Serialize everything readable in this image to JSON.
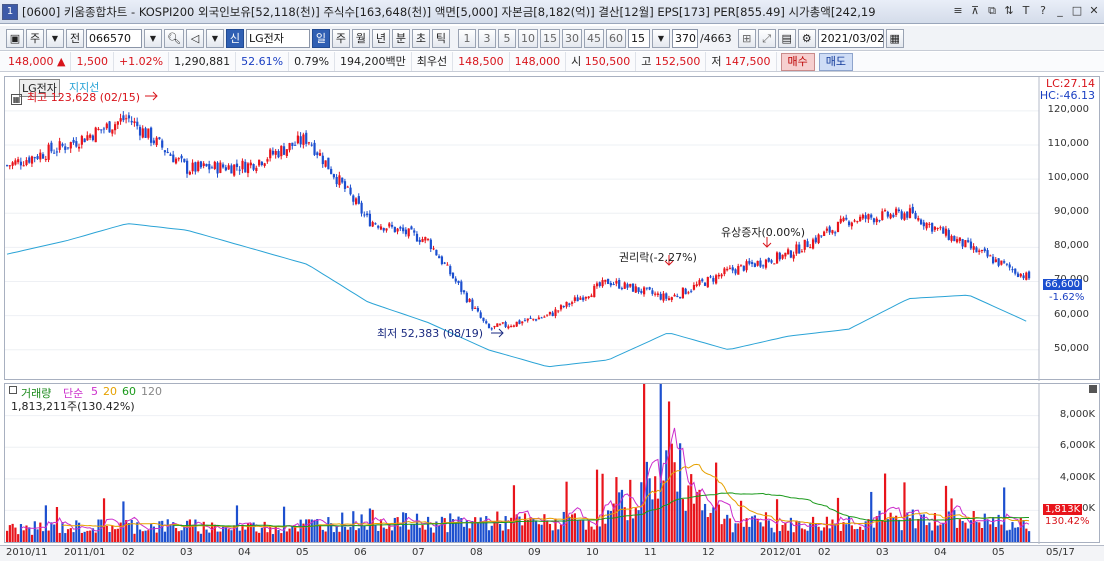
{
  "window": {
    "number": "1",
    "title": "[0600] 키움종합차트 - KOSPI200 외국인보유[52,118(천)] 주식수[163,648(천)] 액면[5,000] 자본금[8,182(억)] 결산[12월] EPS[173] PER[855.49] 시가총액[242,19",
    "title_icons": [
      "menu-icon",
      "pin-icon",
      "restore-icon",
      "layout-icon",
      "text-size-icon",
      "help-icon",
      "minimize-icon",
      "maximize-icon",
      "close-icon"
    ],
    "title_icon_glyphs": [
      "≡",
      "⊼",
      "⧉",
      "⇅",
      "T",
      "?",
      "_",
      "□",
      "✕"
    ]
  },
  "toolbar": {
    "mode1": "주",
    "mode2": "전",
    "stock_code": "066570",
    "stock_badge": "신",
    "stock_name": "LG전자",
    "periods": [
      "일",
      "주",
      "월",
      "년",
      "분",
      "초",
      "틱"
    ],
    "active_period": "일",
    "intervals": [
      "1",
      "3",
      "5",
      "10",
      "15",
      "30",
      "45",
      "60"
    ],
    "interval_value": "15",
    "count_value": "370",
    "count_total": "/4663",
    "date_value": "2021/03/02"
  },
  "quote": {
    "price": "148,000",
    "change_arrow": "▲",
    "change": "1,500",
    "change_pct": "+1.02%",
    "volume": "1,290,881",
    "ratio1": "52.61%",
    "ratio2": "0.79%",
    "amount": "194,200백만",
    "best_label": "최우선",
    "ask": "148,500",
    "bid": "148,000",
    "open_label": "시",
    "open": "150,500",
    "high_label": "고",
    "high": "152,500",
    "low_label": "저",
    "low": "147,500",
    "buy_label": "매수",
    "sell_label": "매도"
  },
  "price_panel": {
    "series_name": "LG전자",
    "indicator_name": "지지선",
    "lc_label": "LC:27.14",
    "hc_label": "HC:-46.13",
    "high_annotation": "최고 123,628 (02/15)",
    "low_annotation": "최저 52,383 (08/19)",
    "event1": "권리락(-2.27%)",
    "event2": "유상증자(0.00%)",
    "current_price": "66,600",
    "current_pct": "-1.62%",
    "y_ticks": [
      "120,000",
      "110,000",
      "100,000",
      "90,000",
      "80,000",
      "70,000",
      "60,000",
      "50,000"
    ]
  },
  "volume_panel": {
    "title": "거래량",
    "ma_label": "단순",
    "ma_periods": [
      "5",
      "20",
      "60",
      "120"
    ],
    "ma_colors": [
      "#cc2fcc",
      "#e6a100",
      "#1b9a1b",
      "#888888"
    ],
    "current_volume": "1,813,211주(130.42%)",
    "current_badge": "1,813K",
    "current_pct": "130.42%",
    "y_ticks": [
      "8,000K",
      "6,000K",
      "4,000K",
      "2,000K"
    ]
  },
  "x_axis": {
    "labels": [
      "2010/11",
      "2011/01",
      "02",
      "03",
      "04",
      "05",
      "06",
      "07",
      "08",
      "09",
      "10",
      "11",
      "12",
      "2012/01",
      "02",
      "03",
      "04",
      "05",
      "05/17"
    ]
  },
  "colors": {
    "up": "#e8141b",
    "down": "#1c4fcf",
    "support_line": "#2aa3d6",
    "accent": "#2f5fb3"
  },
  "chart_data": {
    "type": "line",
    "title": "LG전자",
    "x": [
      "2010/11",
      "2011/01",
      "02",
      "03",
      "04",
      "05",
      "06",
      "07",
      "08",
      "09",
      "10",
      "11",
      "12",
      "2012/01",
      "02",
      "03",
      "04",
      "05"
    ],
    "series": [
      {
        "name": "LG전자",
        "values": [
          104000,
          110000,
          118000,
          103000,
          104000,
          112000,
          88000,
          82000,
          56000,
          60000,
          70000,
          65000,
          73000,
          78000,
          88000,
          90000,
          80000,
          71000
        ]
      },
      {
        "name": "지지선",
        "values": [
          78000,
          82000,
          87000,
          85000,
          80000,
          75000,
          64000,
          58000,
          50000,
          45000,
          47000,
          55000,
          50000,
          54000,
          56000,
          65000,
          66000,
          58000
        ]
      }
    ],
    "volume_series": {
      "name": "거래량",
      "values_k": [
        1500,
        1700,
        1900,
        1800,
        1600,
        2000,
        2600,
        2100,
        2400,
        2200,
        2800,
        8900,
        2200,
        1900,
        2300,
        2600,
        2500,
        1813
      ]
    },
    "ylim": [
      42000,
      127000
    ],
    "volume_ylim_k": [
      0,
      9500
    ]
  }
}
